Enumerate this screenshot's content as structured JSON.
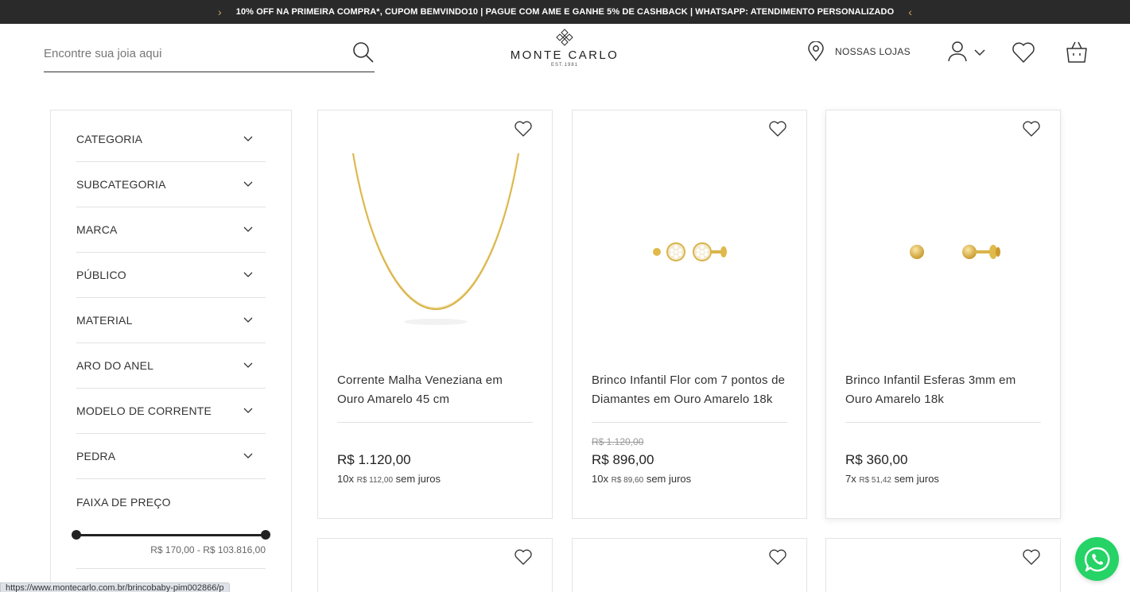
{
  "promo": {
    "text": "10% OFF NA PRIMEIRA COMPRA*, CUPOM BEMVINDO10 | PAGUE COM AME E GANHE 5% DE CASHBACK | WHATSAPP: ATENDIMENTO PERSONALIZADO",
    "prev_icon": "chevron-left-icon",
    "next_icon": "chevron-right-icon"
  },
  "header": {
    "search_placeholder": "Encontre sua joia aqui",
    "logo_name": "MONTE CARLO",
    "logo_est": "EST.1981",
    "stores_label": "NOSSAS LOJAS"
  },
  "filters": {
    "items": [
      {
        "label": "CATEGORIA"
      },
      {
        "label": "SUBCATEGORIA"
      },
      {
        "label": "MARCA"
      },
      {
        "label": "PÚBLICO"
      },
      {
        "label": "MATERIAL"
      },
      {
        "label": "ARO DO ANEL"
      },
      {
        "label": "MODELO DE CORRENTE"
      },
      {
        "label": "PEDRA"
      }
    ],
    "price_label": "FAIXA DE PREÇO",
    "price_range": "R$ 170,00 - R$ 103.816,00"
  },
  "products": [
    {
      "title": "Corrente Malha Veneziana em Ouro Amarelo 45 cm",
      "old_price": "",
      "price": "R$ 1.120,00",
      "inst_count": "10x",
      "inst_value": "R$ 112,00",
      "inst_suffix": "sem juros"
    },
    {
      "title": "Brinco Infantil Flor com 7 pontos de Diamantes em Ouro Amarelo 18k",
      "old_price": "R$ 1.120,00",
      "price": "R$ 896,00",
      "inst_count": "10x",
      "inst_value": "R$ 89,60",
      "inst_suffix": "sem juros"
    },
    {
      "title": "Brinco Infantil Esferas 3mm em Ouro Amarelo 18k",
      "old_price": "",
      "price": "R$ 360,00",
      "inst_count": "7x",
      "inst_value": "R$ 51,42",
      "inst_suffix": "sem juros"
    }
  ],
  "status_url": "https://www.montecarlo.com.br/brincobaby-pim002866/p",
  "colors": {
    "promo_bg": "#2a2a2a",
    "gold": "#d9b44a",
    "whatsapp": "#25d366"
  }
}
